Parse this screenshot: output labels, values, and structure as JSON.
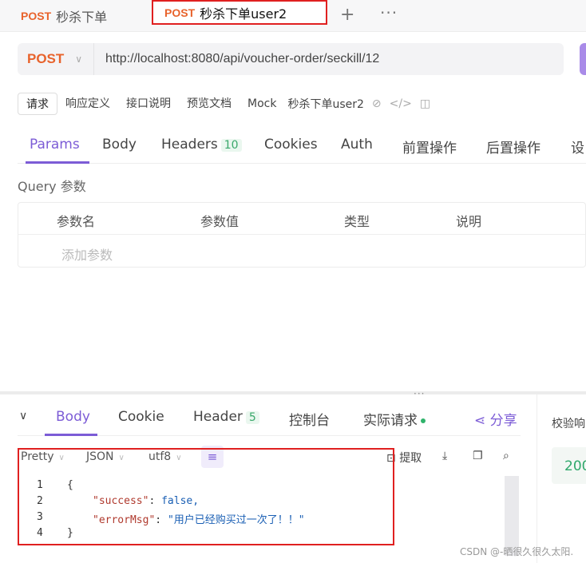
{
  "tabs": [
    {
      "method": "POST",
      "title": "秒杀下单"
    },
    {
      "method": "POST",
      "title": "秒杀下单user2"
    }
  ],
  "request": {
    "method": "POST",
    "url": "http://localhost:8080/api/voucher-order/seckill/12"
  },
  "subtabs": [
    "请求",
    "响应定义",
    "接口说明",
    "预览文档",
    "Mock"
  ],
  "subtab_title": "秒杀下单user2",
  "param_tabs": {
    "params": "Params",
    "body": "Body",
    "headers": "Headers",
    "headers_count": "10",
    "cookies": "Cookies",
    "auth": "Auth",
    "pre": "前置操作",
    "post": "后置操作",
    "settings": "设"
  },
  "query": {
    "label": "Query 参数",
    "columns": [
      "参数名",
      "参数值",
      "类型",
      "说明"
    ],
    "add_placeholder": "添加参数"
  },
  "response_tabs": {
    "body": "Body",
    "cookie": "Cookie",
    "header": "Header",
    "header_count": "5",
    "console": "控制台",
    "actual": "实际请求",
    "share": "分享"
  },
  "side": {
    "label": "校验响",
    "status": "200"
  },
  "format": {
    "pretty": "Pretty",
    "json": "JSON",
    "encoding": "utf8",
    "extract": "提取"
  },
  "code_lines": [
    {
      "num": "1",
      "text": "{"
    },
    {
      "num": "2",
      "key": "\"success\"",
      "sep": ": ",
      "value": "false,"
    },
    {
      "num": "3",
      "key": "\"errorMsg\"",
      "sep": ": ",
      "value": "\"用户已经购买过一次了！！\""
    },
    {
      "num": "4",
      "text": "}"
    }
  ],
  "watermark": "CSDN @-晒很久很久太阳."
}
